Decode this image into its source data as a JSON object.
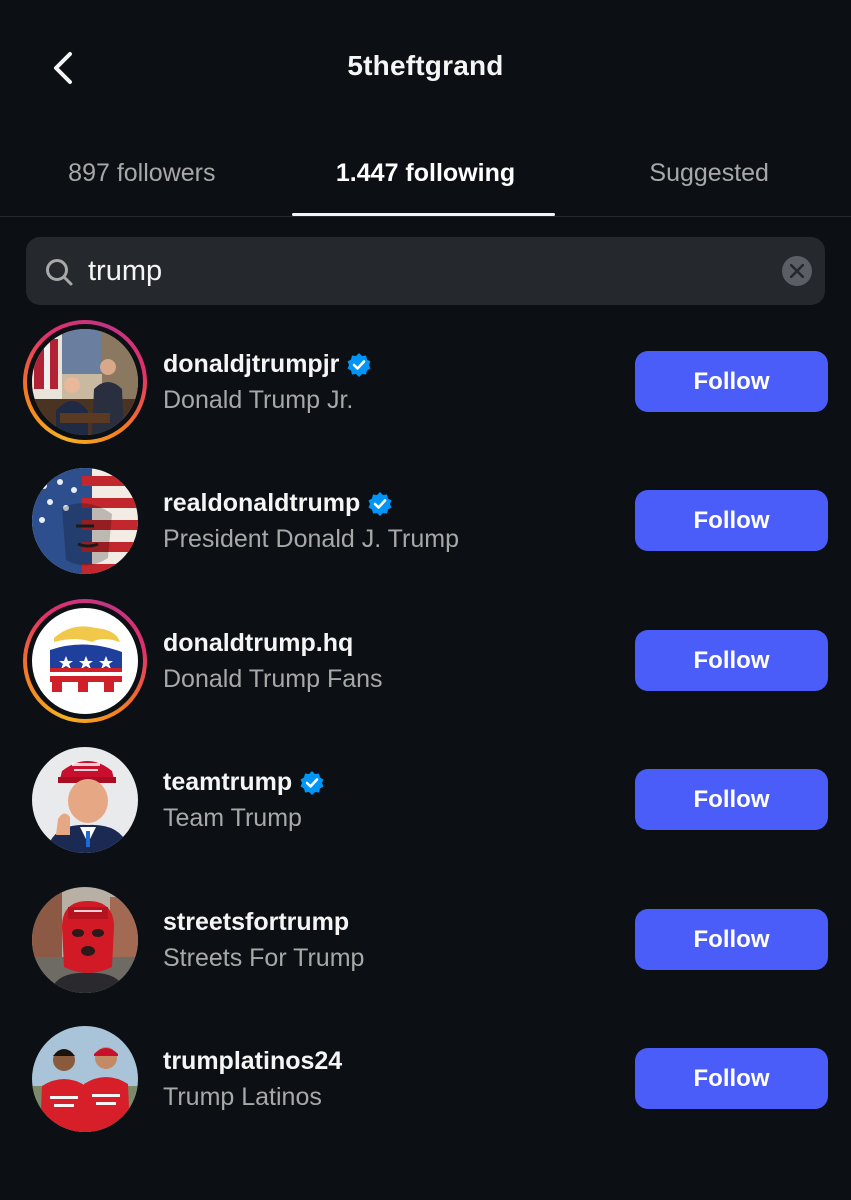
{
  "header": {
    "title": "5theftgrand",
    "back_icon": "chevron-left-icon"
  },
  "tabs": [
    {
      "label": "897 followers",
      "active": false
    },
    {
      "label": "1.447 following",
      "active": true
    },
    {
      "label": "Suggested",
      "active": false
    }
  ],
  "search": {
    "value": "trump",
    "search_icon": "search-icon",
    "clear_icon": "clear-icon"
  },
  "accounts": [
    {
      "username": "donaldjtrumpjr",
      "full_name": "Donald Trump Jr.",
      "verified": true,
      "story_ring": true,
      "button": "Follow"
    },
    {
      "username": "realdonaldtrump",
      "full_name": "President Donald J. Trump",
      "verified": true,
      "story_ring": false,
      "button": "Follow"
    },
    {
      "username": "donaldtrump.hq",
      "full_name": "Donald Trump Fans",
      "verified": false,
      "story_ring": true,
      "button": "Follow"
    },
    {
      "username": "teamtrump",
      "full_name": "Team Trump",
      "verified": true,
      "story_ring": false,
      "button": "Follow"
    },
    {
      "username": "streetsfortrump",
      "full_name": "Streets For Trump",
      "verified": false,
      "story_ring": false,
      "button": "Follow"
    },
    {
      "username": "trumplatinos24",
      "full_name": "Trump Latinos",
      "verified": false,
      "story_ring": false,
      "button": "Follow"
    }
  ],
  "colors": {
    "background": "#0c1014",
    "follow_button": "#4a5df9",
    "verified_badge": "#0095f6",
    "secondary_text": "#a8a8a8"
  }
}
